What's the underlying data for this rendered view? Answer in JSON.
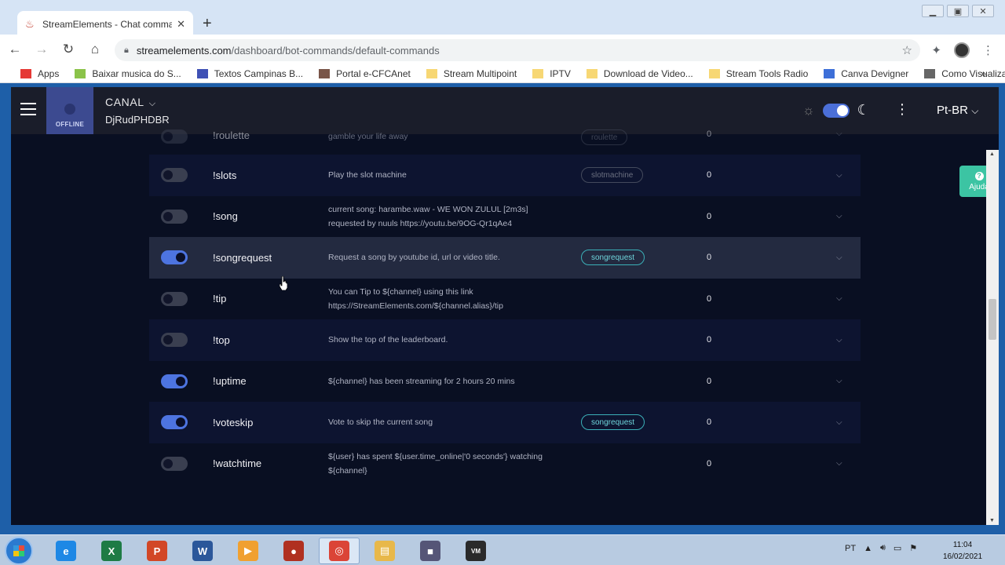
{
  "browser": {
    "tab_title": "StreamElements - Chat comman",
    "new_tab": "+",
    "url_host": "streamelements.com",
    "url_path": "/dashboard/bot-commands/default-commands",
    "bookmarks": [
      {
        "label": "Apps",
        "color": "#e53935"
      },
      {
        "label": "Baixar musica do S...",
        "color": "#8bc34a"
      },
      {
        "label": "Textos Campinas B...",
        "color": "#3f51b5"
      },
      {
        "label": "Portal e-CFCAnet",
        "color": "#795548"
      },
      {
        "label": "Stream Multipoint",
        "color": "#f7d774"
      },
      {
        "label": "IPTV",
        "color": "#f7d774"
      },
      {
        "label": "Download de Video...",
        "color": "#f7d774"
      },
      {
        "label": "Stream Tools Radio",
        "color": "#f7d774"
      },
      {
        "label": "Canva Devigner",
        "color": "#3d6fd8"
      },
      {
        "label": "Como Visualizar Ce...",
        "color": "#666666"
      }
    ],
    "more": "»"
  },
  "app": {
    "offline_label": "OFFLINE",
    "canal_label": "CANAL",
    "channel_name": "DjRudPHDBR",
    "language": "Pt-BR",
    "help_label": "Ajuda"
  },
  "commands": [
    {
      "name": "!roulette",
      "desc": "gamble your life away",
      "tag": "roulette",
      "count": "0",
      "on": false,
      "style": "cut"
    },
    {
      "name": "!slots",
      "desc": "Play the slot machine",
      "tag": "slotmachine",
      "count": "0",
      "on": false,
      "style": "alt"
    },
    {
      "name": "!song",
      "desc": "current song: harambe.waw - WE WON ZULUL [2m3s] requested by nuuls https://youtu.be/9OG-Qr1qAe4",
      "tag": "",
      "count": "0",
      "on": false,
      "style": ""
    },
    {
      "name": "!songrequest",
      "desc": "Request a song by youtube id, url or video title.",
      "tag": "songrequest",
      "count": "0",
      "on": true,
      "style": "hl"
    },
    {
      "name": "!tip",
      "desc": "You can Tip to ${channel} using this link https://StreamElements.com/${channel.alias}/tip",
      "tag": "",
      "count": "0",
      "on": false,
      "style": ""
    },
    {
      "name": "!top",
      "desc": "Show the top of the leaderboard.",
      "tag": "",
      "count": "0",
      "on": false,
      "style": "alt"
    },
    {
      "name": "!uptime",
      "desc": "${channel} has been streaming for 2 hours 20 mins",
      "tag": "",
      "count": "0",
      "on": true,
      "style": ""
    },
    {
      "name": "!voteskip",
      "desc": "Vote to skip the current song",
      "tag": "songrequest",
      "count": "0",
      "on": true,
      "style": "alt"
    },
    {
      "name": "!watchtime",
      "desc": "${user} has spent ${user.time_online|'0 seconds'} watching ${channel}",
      "tag": "",
      "count": "0",
      "on": false,
      "style": ""
    }
  ],
  "taskbar": {
    "apps": [
      {
        "icon": "internet-explorer-icon",
        "color": "#1e88e5",
        "glyph": "e"
      },
      {
        "icon": "excel-icon",
        "color": "#1e7b45",
        "glyph": "X"
      },
      {
        "icon": "powerpoint-icon",
        "color": "#d24726",
        "glyph": "P"
      },
      {
        "icon": "word-icon",
        "color": "#2b579a",
        "glyph": "W"
      },
      {
        "icon": "media-player-icon",
        "color": "#f0a030",
        "glyph": "▶"
      },
      {
        "icon": "obs-icon",
        "color": "#b03020",
        "glyph": "●"
      },
      {
        "icon": "chrome-icon",
        "color": "#db4437",
        "glyph": "◎"
      },
      {
        "icon": "explorer-icon",
        "color": "#e8b84a",
        "glyph": "▤"
      },
      {
        "icon": "recorder-icon",
        "color": "#555577",
        "glyph": "■"
      },
      {
        "icon": "voicemeeter-icon",
        "color": "#2a2a2a",
        "glyph": "VM"
      }
    ],
    "lang": "PT",
    "time": "11:04",
    "date": "16/02/2021"
  }
}
